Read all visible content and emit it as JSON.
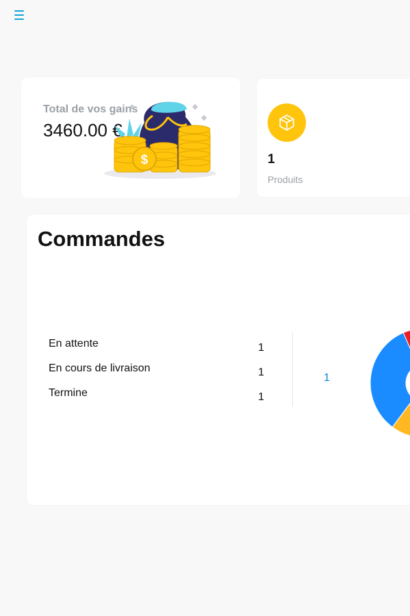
{
  "header": {
    "menu_icon": "hamburger-menu-icon",
    "menu_color": "#0ea5d8"
  },
  "earnings": {
    "label": "Total de vos gains",
    "amount": "3460.00 €",
    "illustration": "money-bag-coins-illustration"
  },
  "products": {
    "icon": "box-icon",
    "icon_bg": "#ffc40c",
    "count": "1",
    "caption": "Produits"
  },
  "orders": {
    "title": "Commandes",
    "statuses": [
      {
        "label": "En attente",
        "value": "1"
      },
      {
        "label": "En cours de livraison",
        "value": "1"
      },
      {
        "label": "Termine",
        "value": "1"
      }
    ],
    "total_label": "1"
  },
  "chart_data": {
    "type": "pie",
    "categories": [
      "En attente",
      "En cours de livraison",
      "Termine"
    ],
    "values": [
      1,
      1,
      1
    ],
    "colors": [
      "#ee1c25",
      "#ffb822",
      "#1a8cff"
    ],
    "donut": true
  }
}
